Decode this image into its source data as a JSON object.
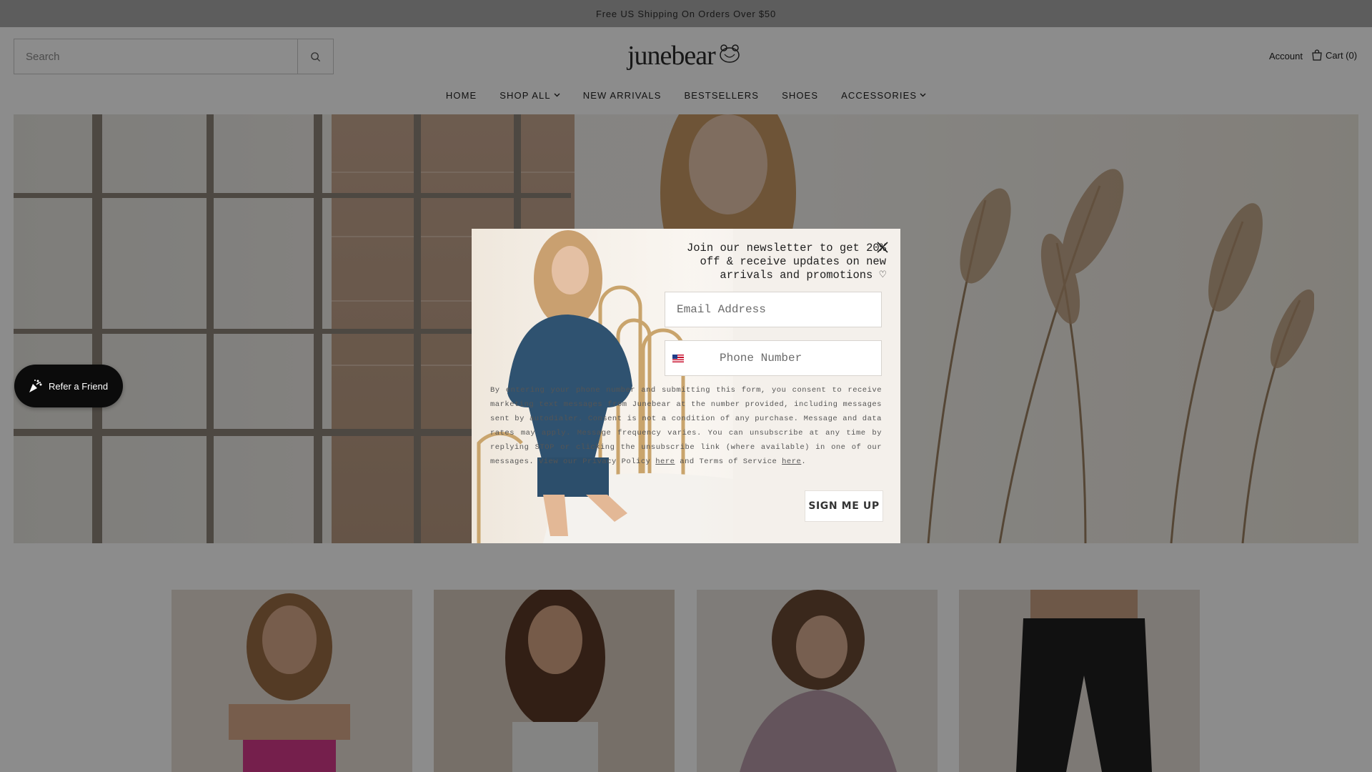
{
  "announcement": {
    "text": "Free US Shipping On Orders Over $50"
  },
  "header": {
    "search_placeholder": "Search",
    "logo_text": "junebear",
    "account_label": "Account",
    "cart_label": "Cart (0)"
  },
  "nav": {
    "items": [
      {
        "label": "HOME",
        "has_dropdown": false
      },
      {
        "label": "SHOP ALL",
        "has_dropdown": true
      },
      {
        "label": "NEW ARRIVALS",
        "has_dropdown": false
      },
      {
        "label": "BESTSELLERS",
        "has_dropdown": false
      },
      {
        "label": "SHOES",
        "has_dropdown": false
      },
      {
        "label": "ACCESSORIES",
        "has_dropdown": true
      }
    ]
  },
  "refer": {
    "label": "Refer a Friend",
    "icon": "confetti-icon"
  },
  "popup": {
    "heading": "Join our newsletter to get 20% off & receive updates on new arrivals and promotions ♡",
    "email_placeholder": "Email Address",
    "phone_placeholder": "Phone Number",
    "phone_country": "US",
    "legal_main": "By entering your phone number and submitting this form, you consent to receive marketing text messages from Junebear at the number provided, including messages sent by autodialer. Consent is not a condition of any purchase. Message and data rates may apply. Message frequency varies. You can unsubscribe at any time by replying STOP or clicking the unsubscribe link (where available) in one of our messages. View our Privacy Policy",
    "legal_link1": "here",
    "legal_mid": "and Terms of Service",
    "legal_link2": "here",
    "signup_label": "SIGN ME UP"
  },
  "colors": {
    "announcement_bg": "#a9a9a9",
    "overlay": "rgba(0,0,0,0.45)",
    "popup_bg": "#f4f0eb",
    "refer_bg": "#0b0b0b"
  }
}
